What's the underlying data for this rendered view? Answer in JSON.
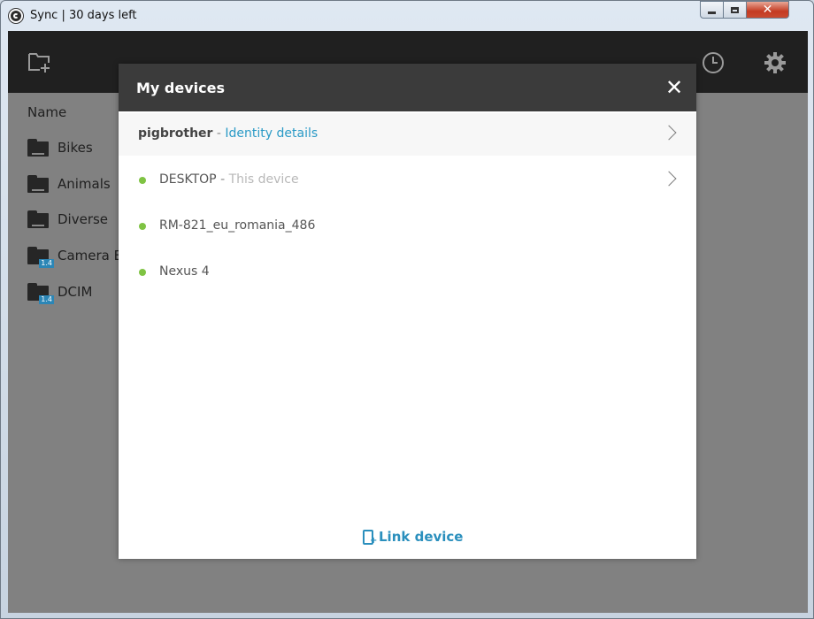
{
  "window": {
    "title": "Sync | 30 days left",
    "minimize_glyph": "",
    "close_glyph": "✕"
  },
  "toolbar": {
    "add_folder_icon": "add-folder-icon",
    "history_icon": "clock-icon",
    "settings_icon": "gear-icon"
  },
  "list": {
    "header": "Name",
    "folders": [
      {
        "label": "Bikes",
        "badge": ""
      },
      {
        "label": "Animals",
        "badge": ""
      },
      {
        "label": "Diverse",
        "badge": ""
      },
      {
        "label": "Camera B",
        "badge": "1.4"
      },
      {
        "label": "DCIM",
        "badge": "1.4"
      }
    ]
  },
  "modal": {
    "title": "My devices",
    "close_glyph": "✕",
    "account": {
      "name": "pigbrother",
      "separator": " - ",
      "link": "Identity details"
    },
    "devices": [
      {
        "name": "DESKTOP",
        "separator": " - ",
        "note": "This device",
        "has_chevron": true
      },
      {
        "name": "RM-821_eu_romania_486",
        "separator": "",
        "note": "",
        "has_chevron": false
      },
      {
        "name": "Nexus 4",
        "separator": "",
        "note": "",
        "has_chevron": false
      }
    ],
    "link_device_label": "Link device"
  },
  "colors": {
    "accent": "#2a9ac6",
    "online_dot": "#7fc343",
    "toolbar": "#202020",
    "modal_header": "#3b3b3b"
  }
}
